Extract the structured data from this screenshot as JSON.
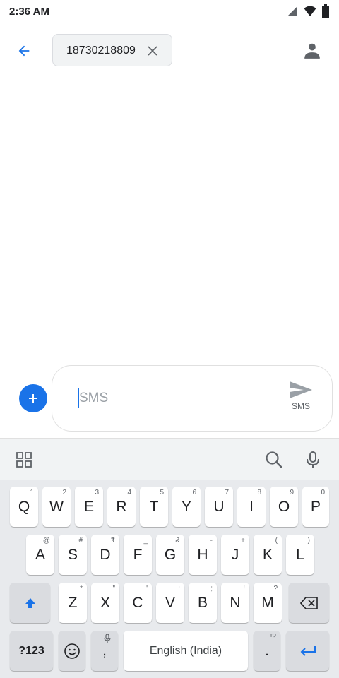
{
  "status_bar": {
    "time": "2:36 AM"
  },
  "recipient": {
    "number": "18730218809"
  },
  "compose": {
    "placeholder": "SMS",
    "send_label": "SMS"
  },
  "keyboard": {
    "row1": [
      {
        "key": "Q",
        "hint": "1"
      },
      {
        "key": "W",
        "hint": "2"
      },
      {
        "key": "E",
        "hint": "3"
      },
      {
        "key": "R",
        "hint": "4"
      },
      {
        "key": "T",
        "hint": "5"
      },
      {
        "key": "Y",
        "hint": "6"
      },
      {
        "key": "U",
        "hint": "7"
      },
      {
        "key": "I",
        "hint": "8"
      },
      {
        "key": "O",
        "hint": "9"
      },
      {
        "key": "P",
        "hint": "0"
      }
    ],
    "row2": [
      {
        "key": "A",
        "hint": "@"
      },
      {
        "key": "S",
        "hint": "#"
      },
      {
        "key": "D",
        "hint": "₹"
      },
      {
        "key": "F",
        "hint": "_"
      },
      {
        "key": "G",
        "hint": "&"
      },
      {
        "key": "H",
        "hint": "-"
      },
      {
        "key": "J",
        "hint": "+"
      },
      {
        "key": "K",
        "hint": "("
      },
      {
        "key": "L",
        "hint": ")"
      }
    ],
    "row3": [
      {
        "key": "Z",
        "hint": "*"
      },
      {
        "key": "X",
        "hint": "\""
      },
      {
        "key": "C",
        "hint": "'"
      },
      {
        "key": "V",
        "hint": ":"
      },
      {
        "key": "B",
        "hint": ";"
      },
      {
        "key": "N",
        "hint": "!"
      },
      {
        "key": "M",
        "hint": "?"
      }
    ],
    "symbols_label": "?123",
    "comma": ",",
    "space_label": "English (India)",
    "period": ".",
    "period_hint": "!?"
  }
}
